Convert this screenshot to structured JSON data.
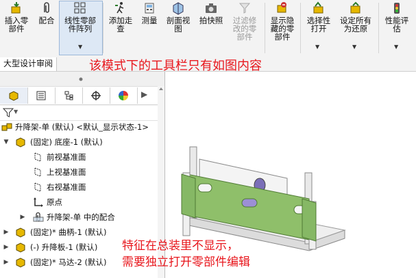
{
  "ribbon": {
    "buttons": [
      {
        "label": "插入零\n部件",
        "icon": "insert-component-icon"
      },
      {
        "label": "配合",
        "icon": "mate-paperclip-icon"
      },
      {
        "label": "线性零部\n件阵列",
        "icon": "linear-pattern-icon"
      },
      {
        "label": "添加走\n查",
        "icon": "walkthrough-icon"
      },
      {
        "label": "测量",
        "icon": "measure-icon"
      },
      {
        "label": "剖面视\n图",
        "icon": "section-view-icon"
      },
      {
        "label": "拍快照",
        "icon": "snapshot-camera-icon"
      },
      {
        "label": "过滤修\n改的零\n部件",
        "icon": "filter-modified-icon"
      },
      {
        "label": "显示隐\n藏的零\n部件",
        "icon": "show-hidden-icon"
      },
      {
        "label": "选择性\n打开",
        "icon": "selective-open-icon"
      },
      {
        "label": "设定所有\n为还原",
        "icon": "set-resolved-icon"
      },
      {
        "label": "性能评\n估",
        "icon": "performance-icon"
      }
    ]
  },
  "tab": {
    "label": "大型设计审阅"
  },
  "annotations": {
    "top": "该模式下的工具栏只有如图内容",
    "bottom": "特征在总装里不显示，\n需要独立打开零部件编辑"
  },
  "tree": {
    "root": "升降架-单 (默认) <默认_显示状态-1>",
    "items": [
      {
        "label": "(固定) 底座-1 (默认)"
      },
      {
        "label": "前视基准面"
      },
      {
        "label": "上视基准面"
      },
      {
        "label": "右视基准面"
      },
      {
        "label": "原点"
      },
      {
        "label": "升降架-单 中的配合"
      },
      {
        "label": "(固定)* 曲柄-1 (默认)"
      },
      {
        "label": "(-) 升降板-1 (默认)"
      },
      {
        "label": "(固定)* 马达-2 (默认)"
      }
    ]
  },
  "colors": {
    "accent_red": "#e8161c",
    "part_green": "#8fbf6a",
    "part_gray": "#c9c9c9",
    "part_yellow": "#e6b800"
  }
}
